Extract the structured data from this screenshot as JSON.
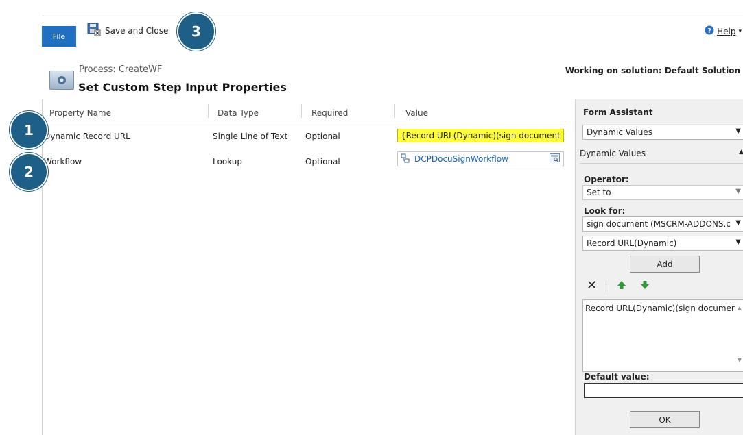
{
  "ribbon": {
    "file_label": "File",
    "save_close_label": "Save and Close",
    "help_label": "Help"
  },
  "callouts": [
    "1",
    "2",
    "3"
  ],
  "header": {
    "process_label": "Process: CreateWF",
    "title": "Set Custom Step Input Properties",
    "solution_text": "Working on solution: Default Solution"
  },
  "grid": {
    "columns": [
      "Property Name",
      "Data Type",
      "Required",
      "Value"
    ],
    "rows": [
      {
        "name": "Dynamic Record URL",
        "type": "Single Line of Text",
        "required": "Optional",
        "value": "{Record URL(Dynamic)(sign document (M"
      },
      {
        "name": "Workflow",
        "type": "Lookup",
        "required": "Optional",
        "value": "DCPDocuSignWorkflow"
      }
    ]
  },
  "form_assistant": {
    "title": "Form Assistant",
    "top_select": "Dynamic Values",
    "section_label": "Dynamic Values",
    "operator_label": "Operator:",
    "operator_value": "Set to",
    "look_for_label": "Look for:",
    "look_for_entity": "sign document (MSCRM-ADDONS.c",
    "look_for_field": "Record URL(Dynamic)",
    "add_label": "Add",
    "list_item": "Record URL(Dynamic)(sign documer",
    "default_value_label": "Default value:",
    "ok_label": "OK"
  },
  "colors": {
    "file_blue": "#1f6fc2",
    "callout": "#1d5f86",
    "highlight": "#ffff33",
    "link": "#1160b7"
  }
}
